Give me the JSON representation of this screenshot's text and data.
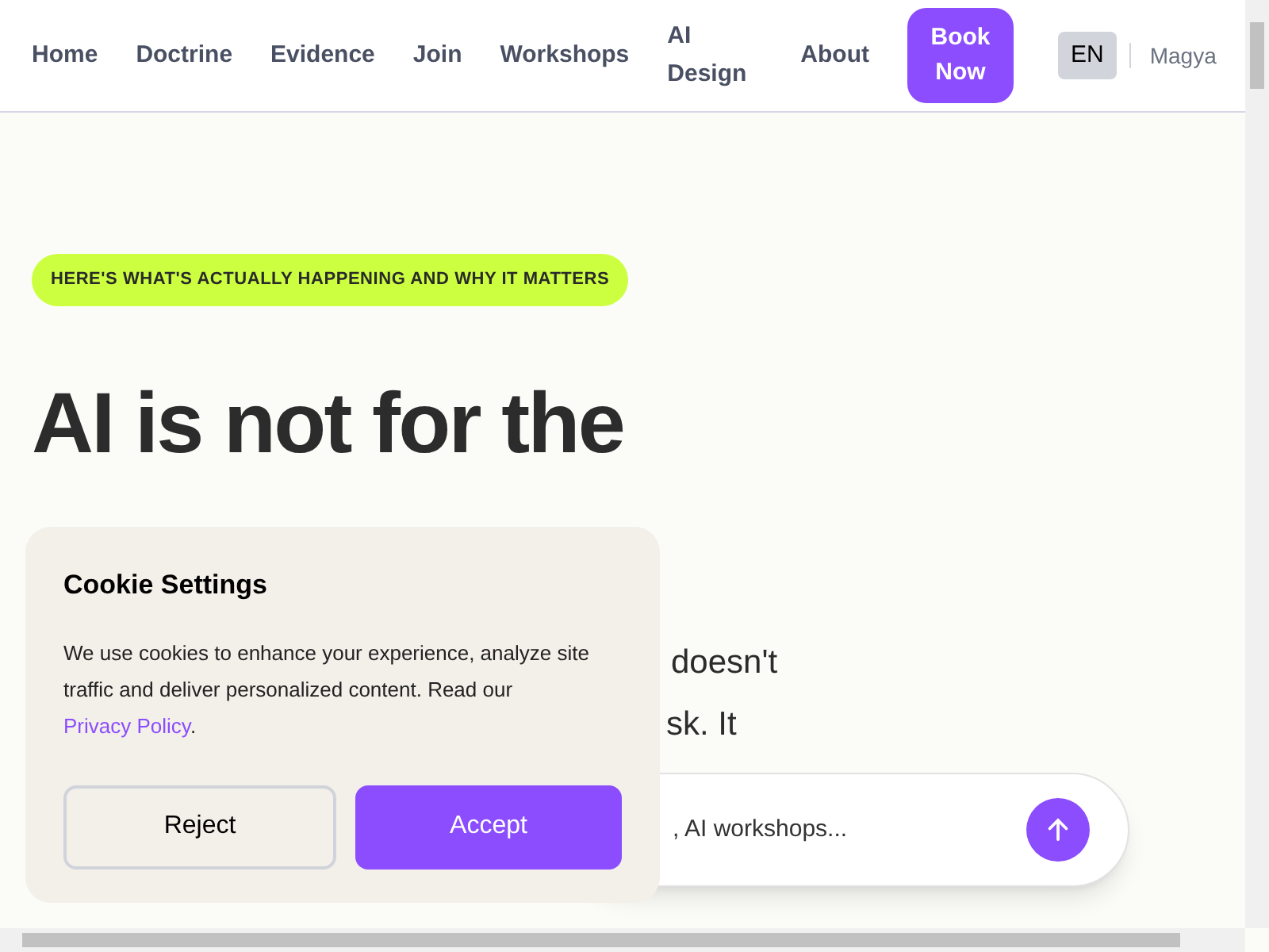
{
  "nav": {
    "links": [
      "Home",
      "Doctrine",
      "Evidence",
      "Join",
      "Workshops",
      "AI Design",
      "About"
    ],
    "cta": "Book Now",
    "languages": [
      {
        "label": "EN",
        "selected": true
      },
      {
        "label": "Magya",
        "selected": false
      }
    ]
  },
  "hero": {
    "badge": "HERE'S WHAT'S ACTUALLY HAPPENING AND WHY IT MATTERS",
    "heading": "AI is not for the",
    "lines": [
      "doesn't",
      "sk. It"
    ],
    "search": {
      "placeholder": ", AI workshops..."
    }
  },
  "cookie": {
    "title": "Cookie Settings",
    "text": "We use cookies to enhance your experience, analyze site traffic and deliver personalized content. Read our",
    "link": "Privacy Policy",
    "after": ".",
    "buttons": [
      {
        "label": "Reject",
        "kind": "secondary"
      },
      {
        "label": "Accept",
        "kind": "primary"
      }
    ]
  }
}
